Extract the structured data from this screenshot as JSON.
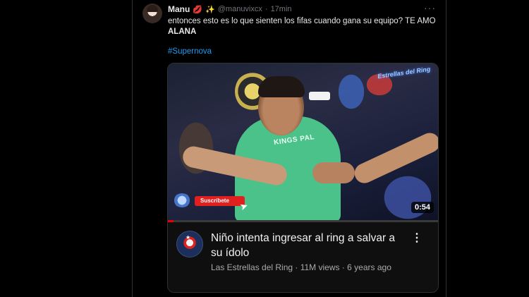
{
  "tweet": {
    "author_name": "Manu",
    "emoji_lips": "💋",
    "emoji_sparkles": "✨",
    "handle": "@manuvixcx",
    "dot": "·",
    "time": "17min",
    "more_icon": "···",
    "text_line": "entonces esto es lo que sienten los fifas cuando gana su equipo? TE AMO",
    "text_bold": "ALANA",
    "hashtag": "#Supernova"
  },
  "video": {
    "shirt_text": "KINGS PAL",
    "watermark": "Estrellas del Ring",
    "subscribe_label": "Suscríbete",
    "duration": "0:54",
    "progress": 0.02,
    "title": "Niño intenta ingresar al ring a salvar a su ídolo",
    "meta": "Las Estrellas del Ring · 11M views · 6 years ago",
    "more_icon": "⋮"
  },
  "colors": {
    "background": "#000000",
    "link": "#1d9bf0",
    "subscribe": "#e0201f",
    "shirt": "#4ac28a"
  },
  "icons": [
    "lips-emoji",
    "sparkles-emoji",
    "more-horizontal-icon",
    "cursor-icon",
    "more-vertical-icon"
  ]
}
